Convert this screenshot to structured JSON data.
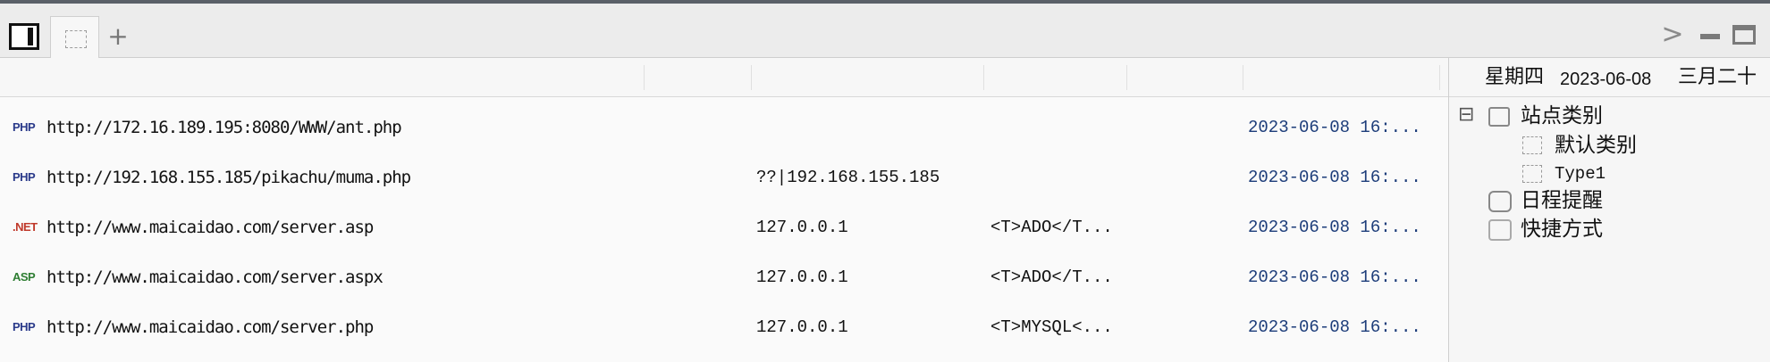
{
  "tabbar": {
    "panel_toggle_icon": "panel-toggle-icon",
    "tab_icon": "dashed-box-icon",
    "add_tab_label": "+",
    "next_label": ">",
    "minimize_icon": "minimize-icon",
    "maximize_icon": "maximize-icon"
  },
  "shells": [
    {
      "badge": "PHP",
      "badge_color": "#2a3a8a",
      "url": "http://172.16.189.195:8080/WWW/ant.php",
      "ip": "",
      "note": "",
      "time": "2023-06-08 16:..."
    },
    {
      "badge": "PHP",
      "badge_color": "#2a3a8a",
      "url": "http://192.168.155.185/pikachu/muma.php",
      "ip": "??|192.168.155.185",
      "note": "",
      "time": "2023-06-08 16:..."
    },
    {
      "badge": ".NET",
      "badge_color": "#c0392b",
      "url": "http://www.maicaidao.com/server.asp",
      "ip": "127.0.0.1",
      "note": "<T>ADO</T...",
      "time": "2023-06-08 16:..."
    },
    {
      "badge": "ASP",
      "badge_color": "#2e7d32",
      "url": "http://www.maicaidao.com/server.aspx",
      "ip": "127.0.0.1",
      "note": "<T>ADO</T...",
      "time": "2023-06-08 16:..."
    },
    {
      "badge": "PHP",
      "badge_color": "#2a3a8a",
      "url": "http://www.maicaidao.com/server.php",
      "ip": "127.0.0.1",
      "note": "<T>MYSQL<...",
      "time": "2023-06-08 16:..."
    }
  ],
  "sidebar": {
    "weekday": "星期四",
    "date": "2023-06-08",
    "lunar": "三月二十",
    "tree": {
      "collapse_label": "⊟",
      "root": "站点类别",
      "children": [
        "默认类别",
        "Type1"
      ],
      "schedule": "日程提醒",
      "shortcuts": "快捷方式"
    }
  }
}
